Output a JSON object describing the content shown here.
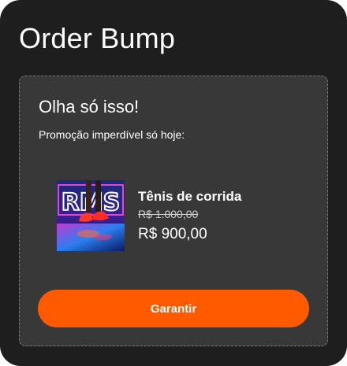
{
  "page": {
    "title": "Order Bump"
  },
  "bump": {
    "headline": "Olha só isso!",
    "subheadline": "Promoção imperdível só hoje:",
    "product": {
      "name": "Tênis de corrida",
      "old_price": "R$ 1.000,00",
      "price": "R$ 900,00",
      "image_text": "RMS",
      "image_icon": "running-shoes-photo"
    },
    "cta_label": "Garantir"
  },
  "colors": {
    "background": "#1e1e1e",
    "panel": "#383838",
    "accent": "#ff5a00",
    "text": "#ffffff"
  }
}
